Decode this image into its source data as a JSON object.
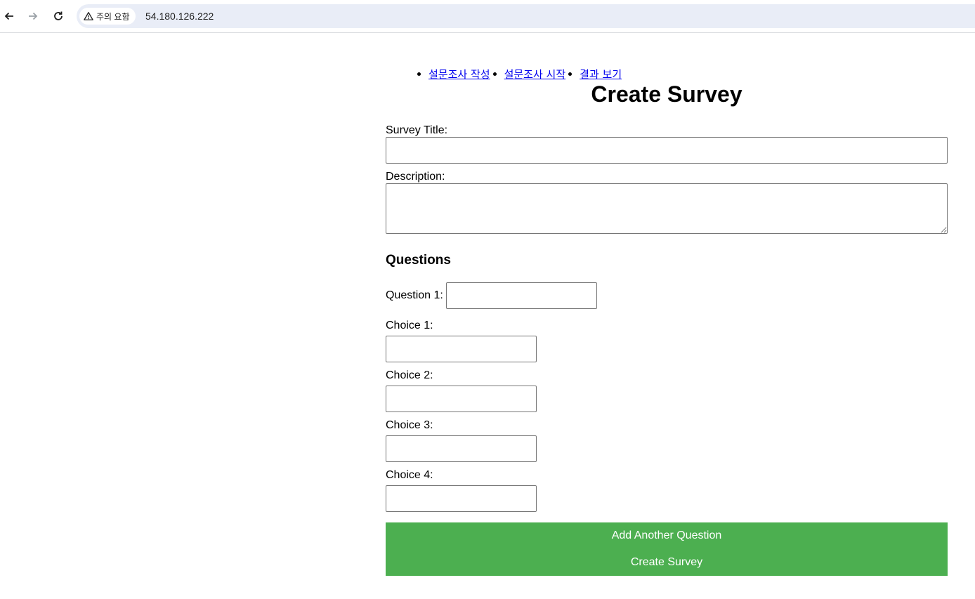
{
  "browser": {
    "back_icon": "arrow-left-icon",
    "forward_icon": "arrow-right-icon",
    "reload_icon": "reload-icon",
    "security_label": "주의 요함",
    "security_icon": "warning-triangle-icon",
    "url": "54.180.126.222"
  },
  "nav": {
    "items": [
      {
        "label": "설문조사 작성"
      },
      {
        "label": "설문조사 시작"
      },
      {
        "label": "결과 보기"
      }
    ]
  },
  "form": {
    "title": "Create Survey",
    "survey_title_label": "Survey Title:",
    "survey_title_value": "",
    "description_label": "Description:",
    "description_value": "",
    "questions_heading": "Questions",
    "question": {
      "label": "Question 1:",
      "value": "",
      "choices": [
        {
          "label": "Choice 1:",
          "value": ""
        },
        {
          "label": "Choice 2:",
          "value": ""
        },
        {
          "label": "Choice 3:",
          "value": ""
        },
        {
          "label": "Choice 4:",
          "value": ""
        }
      ]
    },
    "add_question_button": "Add Another Question",
    "create_button": "Create Survey",
    "button_color": "#4caf50"
  }
}
